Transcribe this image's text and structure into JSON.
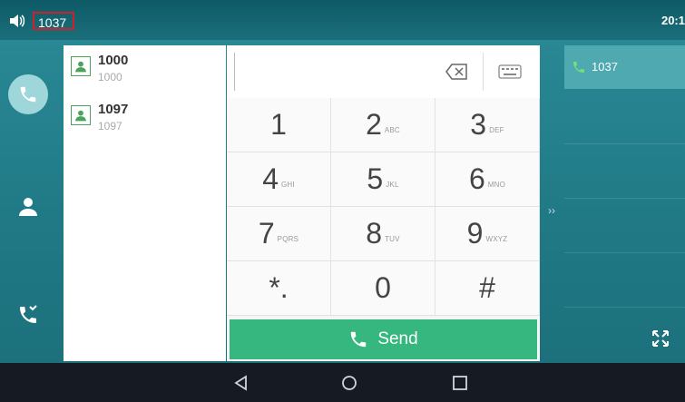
{
  "status_bar": {
    "volume_icon": "speaker-icon",
    "extension": "1037",
    "time": "20:1"
  },
  "left_nav": {
    "items": [
      {
        "name": "dialer",
        "icon": "phone-icon",
        "active": true
      },
      {
        "name": "directory",
        "icon": "person-icon",
        "active": false
      },
      {
        "name": "history",
        "icon": "call-history-icon",
        "active": false
      }
    ]
  },
  "contacts": [
    {
      "name": "1000",
      "number": "1000"
    },
    {
      "name": "1097",
      "number": "1097"
    }
  ],
  "dialpad": {
    "input_value": "",
    "keys": [
      {
        "digit": "1",
        "letters": ""
      },
      {
        "digit": "2",
        "letters": "ABC"
      },
      {
        "digit": "3",
        "letters": "DEF"
      },
      {
        "digit": "4",
        "letters": "GHI"
      },
      {
        "digit": "5",
        "letters": "JKL"
      },
      {
        "digit": "6",
        "letters": "MNO"
      },
      {
        "digit": "7",
        "letters": "PQRS"
      },
      {
        "digit": "8",
        "letters": "TUV"
      },
      {
        "digit": "9",
        "letters": "WXYZ"
      },
      {
        "digit": "*.",
        "letters": ""
      },
      {
        "digit": "0",
        "letters": ""
      },
      {
        "digit": "#",
        "letters": ""
      }
    ],
    "send_label": "Send"
  },
  "line_panel": {
    "line_label": "1037"
  },
  "colors": {
    "accent_green": "#35b77f",
    "teal_bg": "#1f7884",
    "status_red": "#d0202a"
  }
}
